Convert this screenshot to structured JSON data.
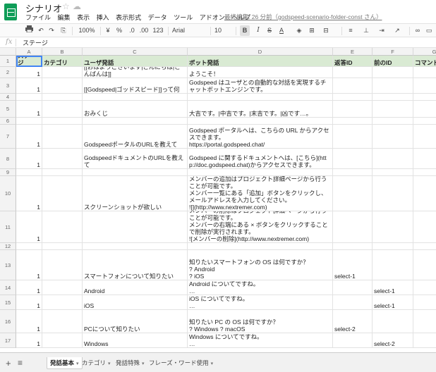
{
  "app": {
    "title": "シナリオ",
    "star_glyph": "☆",
    "drive_glyph": "☁",
    "last_edit": "最終編集: 26 分前（godspeed-scenario-folder-const さん）",
    "menus": [
      "ファイル",
      "編集",
      "表示",
      "挿入",
      "表示形式",
      "データ",
      "ツール",
      "アドオン",
      "ヘルプ"
    ]
  },
  "toolbar": {
    "print_icon": "printer-icon",
    "zoom": "100%",
    "currency": "¥",
    "percent": "%",
    "decimal_less": ".0",
    "decimal_more": ".00",
    "more_formats": "123",
    "font": "Arial",
    "size": "10",
    "bold": "B",
    "italic": "I",
    "strike": "S",
    "textcolor": "A"
  },
  "formula_bar": {
    "fx": "fx",
    "value": "ステージ"
  },
  "sheet": {
    "columns": [
      "A",
      "B",
      "C",
      "D",
      "E",
      "F",
      "G"
    ],
    "rows": [
      {
        "n": "1",
        "c": [
          "ステージ",
          "カテゴリ",
          "ユーザ発話",
          "ボット発話",
          "返答ID",
          "前のID",
          "コマンド"
        ]
      },
      {
        "n": "2",
        "c": [
          "1",
          "",
          "[[おはようございます|こんにちは|こんばんは]]",
          "ようこそ！",
          "",
          "",
          ""
        ]
      },
      {
        "n": "3",
        "c": [
          "1",
          "",
          "[[Godspeed|ゴッドスピード]]って何",
          "Godspeed はユーザとの自動的な対話を実現するチャットボットエンジンです。",
          "",
          "",
          ""
        ]
      },
      {
        "n": "4",
        "c": [
          "",
          "",
          "",
          "",
          "",
          "",
          ""
        ]
      },
      {
        "n": "5",
        "c": [
          "1",
          "",
          "おみくじ",
          "大吉です。|中吉です。|末吉です。|凶です…。",
          "",
          "",
          ""
        ]
      },
      {
        "n": "6",
        "c": [
          "",
          "",
          "",
          "",
          "",
          "",
          ""
        ]
      },
      {
        "n": "7",
        "c": [
          "1",
          "",
          "GodspeedポータルのURLを教えて",
          "Godspeed ポータルへは、こちらの URL からアクセスできます。\nhttps://portal.godspeed.chat/",
          "",
          "",
          ""
        ]
      },
      {
        "n": "8",
        "c": [
          "1",
          "",
          "GodspeedドキュメントのURLを教えて",
          "Godspeed に関するドキュメントへは、[こちら](http://doc.godspeed.chat)からアクセスできます。",
          "",
          "",
          ""
        ]
      },
      {
        "n": "9",
        "c": [
          "",
          "",
          "",
          "",
          "",
          "",
          ""
        ]
      },
      {
        "n": "10",
        "c": [
          "1",
          "",
          "スクリーンショットが欲しい",
          "メンバーの追加はプロジェクト詳細ページから行うことが可能です。\nメンバー一覧にある「追加」ボタンをクリックし、メールアドレスを入力してください。\n![](http://www.nextremer.com)",
          "",
          "",
          ""
        ]
      },
      {
        "n": "11",
        "c": [
          "1",
          "",
          "",
          "メンバーの削除はプロジェクト詳細ページから行うことが可能です。\nメンバーの右端にある × ボタンをクリックすることで削除が実行されます。\n![メンバーの削除](http://www.nextremer.com)",
          "",
          "",
          ""
        ]
      },
      {
        "n": "12",
        "c": [
          "",
          "",
          "",
          "",
          "",
          "",
          ""
        ]
      },
      {
        "n": "13",
        "c": [
          "1",
          "",
          "スマートフォンについて知りたい",
          "知りたいスマートフォンの OS は何ですか？\n? Android\n? iOS",
          "select-1",
          "",
          ""
        ]
      },
      {
        "n": "14",
        "c": [
          "1",
          "",
          "Android",
          "Android についてですね。\n…",
          "",
          "select-1",
          ""
        ]
      },
      {
        "n": "15",
        "c": [
          "1",
          "",
          "iOS",
          "iOS についてですね。\n…",
          "",
          "select-1",
          ""
        ]
      },
      {
        "n": "16",
        "c": [
          "1",
          "",
          "PCについて知りたい",
          "知りたい PC の OS は何ですか？\n? Windows ? macOS",
          "select-2",
          "",
          ""
        ]
      },
      {
        "n": "17",
        "c": [
          "1",
          "",
          "Windows",
          "Windows についてですね。\n…",
          "",
          "select-2",
          ""
        ]
      }
    ]
  },
  "tabs": {
    "add": "+",
    "list": "≡",
    "items": [
      "発話基本",
      "カテゴリ",
      "発話特殊",
      "フレーズ・ワード使用"
    ]
  }
}
